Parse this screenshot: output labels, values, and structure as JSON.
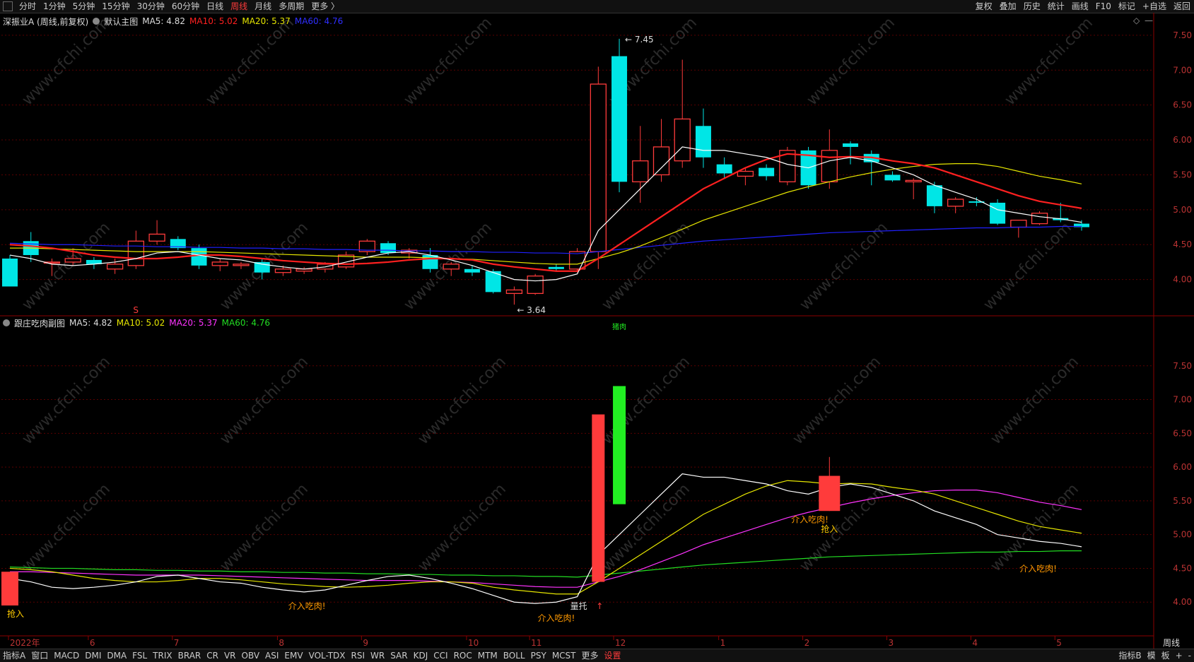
{
  "toolbar": {
    "left_items": [
      "分时",
      "1分钟",
      "5分钟",
      "15分钟",
      "30分钟",
      "60分钟",
      "日线",
      "周线",
      "月线",
      "多周期",
      "更多 〉"
    ],
    "active": "周线",
    "right_items": [
      "复权",
      "叠加",
      "历史",
      "统计",
      "画线",
      "F10",
      "标记",
      "+自选",
      "返回"
    ]
  },
  "main_title": {
    "name": "深振业A (周线,前复权)",
    "panel": "默认主图",
    "ma5": "MA5: 4.82",
    "ma10": "MA10: 5.02",
    "ma20": "MA20: 5.37",
    "ma60": "MA60: 4.76"
  },
  "sub_title": {
    "panel": "跟庄吃肉副图",
    "ma5": "MA5: 4.82",
    "ma10": "MA10: 5.02",
    "ma20": "MA20: 5.37",
    "ma60": "MA60: 4.76"
  },
  "bottombar": {
    "items": [
      "指标A",
      "窗口",
      "MACD",
      "DMI",
      "DMA",
      "FSL",
      "TRIX",
      "BRAR",
      "CR",
      "VR",
      "OBV",
      "ASI",
      "EMV",
      "VOL-TDX",
      "RSI",
      "WR",
      "SAR",
      "KDJ",
      "CCI",
      "ROC",
      "MTM",
      "BOLL",
      "PSY",
      "MCST",
      "更多",
      "设置"
    ],
    "active": "设置",
    "right_items": [
      "指标B",
      "模",
      "板",
      "+",
      "-"
    ]
  },
  "period_label": "周线",
  "watermark": "www.cfchi.com",
  "colors": {
    "up": "#ff3b3b",
    "down": "#00e6e6",
    "ma5": "#ffffff",
    "ma10": "#ff2020",
    "ma20": "#e6e600",
    "ma60_main": "#2020ff",
    "ma10_sub": "#e6e600",
    "ma20_sub": "#ff33ff",
    "ma60_sub": "#22dd22",
    "green_bar": "#22ee22",
    "annot": "#ff9900"
  },
  "chart_data": [
    {
      "type": "candlestick",
      "title": "默认主图",
      "yaxis_ticks": [
        4.0,
        4.5,
        5.0,
        5.5,
        6.0,
        6.5,
        7.0,
        7.5
      ],
      "ylim": [
        3.5,
        7.6
      ],
      "x_tick_labels": [
        "2022年",
        "6",
        "7",
        "8",
        "9",
        "10",
        "11",
        "12",
        "1",
        "2",
        "3",
        "4",
        "5"
      ],
      "candles": [
        {
          "o": 4.3,
          "h": 4.35,
          "l": 3.9,
          "c": 3.9
        },
        {
          "o": 4.55,
          "h": 4.68,
          "l": 4.25,
          "c": 4.35
        },
        {
          "o": 4.25,
          "h": 4.3,
          "l": 4.05,
          "c": 4.25
        },
        {
          "o": 4.25,
          "h": 4.45,
          "l": 4.2,
          "c": 4.3
        },
        {
          "o": 4.28,
          "h": 4.32,
          "l": 4.15,
          "c": 4.22
        },
        {
          "o": 4.15,
          "h": 4.3,
          "l": 4.08,
          "c": 4.22
        },
        {
          "o": 4.2,
          "h": 4.7,
          "l": 4.15,
          "c": 4.55
        },
        {
          "o": 4.55,
          "h": 4.85,
          "l": 4.5,
          "c": 4.65
        },
        {
          "o": 4.58,
          "h": 4.62,
          "l": 4.42,
          "c": 4.45
        },
        {
          "o": 4.45,
          "h": 4.5,
          "l": 4.15,
          "c": 4.2
        },
        {
          "o": 4.2,
          "h": 4.3,
          "l": 4.12,
          "c": 4.25
        },
        {
          "o": 4.2,
          "h": 4.25,
          "l": 4.15,
          "c": 4.22
        },
        {
          "o": 4.25,
          "h": 4.3,
          "l": 4.0,
          "c": 4.1
        },
        {
          "o": 4.1,
          "h": 4.2,
          "l": 4.05,
          "c": 4.15
        },
        {
          "o": 4.12,
          "h": 4.18,
          "l": 4.08,
          "c": 4.15
        },
        {
          "o": 4.15,
          "h": 4.25,
          "l": 4.1,
          "c": 4.22
        },
        {
          "o": 4.18,
          "h": 4.4,
          "l": 4.15,
          "c": 4.35
        },
        {
          "o": 4.4,
          "h": 4.58,
          "l": 4.35,
          "c": 4.55
        },
        {
          "o": 4.52,
          "h": 4.55,
          "l": 4.35,
          "c": 4.38
        },
        {
          "o": 4.38,
          "h": 4.45,
          "l": 4.3,
          "c": 4.42
        },
        {
          "o": 4.35,
          "h": 4.45,
          "l": 4.1,
          "c": 4.15
        },
        {
          "o": 4.15,
          "h": 4.25,
          "l": 4.05,
          "c": 4.22
        },
        {
          "o": 4.15,
          "h": 4.2,
          "l": 4.05,
          "c": 4.1
        },
        {
          "o": 4.12,
          "h": 4.15,
          "l": 3.8,
          "c": 3.82
        },
        {
          "o": 3.8,
          "h": 3.9,
          "l": 3.64,
          "c": 3.85
        },
        {
          "o": 3.8,
          "h": 4.08,
          "l": 3.78,
          "c": 4.05
        },
        {
          "o": 4.18,
          "h": 4.22,
          "l": 4.12,
          "c": 4.15
        },
        {
          "o": 4.15,
          "h": 4.45,
          "l": 4.1,
          "c": 4.4
        },
        {
          "o": 4.4,
          "h": 7.05,
          "l": 4.15,
          "c": 6.8
        },
        {
          "o": 7.2,
          "h": 7.45,
          "l": 5.25,
          "c": 5.4
        },
        {
          "o": 5.4,
          "h": 6.2,
          "l": 5.1,
          "c": 5.7
        },
        {
          "o": 5.5,
          "h": 6.3,
          "l": 5.4,
          "c": 5.9
        },
        {
          "o": 5.7,
          "h": 7.15,
          "l": 5.6,
          "c": 6.3
        },
        {
          "o": 6.2,
          "h": 6.45,
          "l": 5.6,
          "c": 5.75
        },
        {
          "o": 5.65,
          "h": 5.75,
          "l": 5.45,
          "c": 5.52
        },
        {
          "o": 5.48,
          "h": 5.6,
          "l": 5.35,
          "c": 5.55
        },
        {
          "o": 5.6,
          "h": 5.65,
          "l": 5.42,
          "c": 5.48
        },
        {
          "o": 5.4,
          "h": 5.9,
          "l": 5.35,
          "c": 5.85
        },
        {
          "o": 5.85,
          "h": 5.9,
          "l": 5.3,
          "c": 5.35
        },
        {
          "o": 5.4,
          "h": 6.15,
          "l": 5.3,
          "c": 5.85
        },
        {
          "o": 5.95,
          "h": 5.98,
          "l": 5.65,
          "c": 5.9
        },
        {
          "o": 5.8,
          "h": 5.85,
          "l": 5.35,
          "c": 5.68
        },
        {
          "o": 5.5,
          "h": 5.55,
          "l": 5.4,
          "c": 5.42
        },
        {
          "o": 5.4,
          "h": 5.45,
          "l": 5.15,
          "c": 5.42
        },
        {
          "o": 5.35,
          "h": 5.4,
          "l": 4.95,
          "c": 5.05
        },
        {
          "o": 5.05,
          "h": 5.18,
          "l": 4.95,
          "c": 5.15
        },
        {
          "o": 5.12,
          "h": 5.18,
          "l": 5.05,
          "c": 5.1
        },
        {
          "o": 5.1,
          "h": 5.15,
          "l": 4.78,
          "c": 4.8
        },
        {
          "o": 4.75,
          "h": 4.85,
          "l": 4.6,
          "c": 4.85
        },
        {
          "o": 4.8,
          "h": 4.98,
          "l": 4.78,
          "c": 4.95
        },
        {
          "o": 4.88,
          "h": 5.1,
          "l": 4.82,
          "c": 4.85
        },
        {
          "o": 4.8,
          "h": 4.85,
          "l": 4.7,
          "c": 4.75
        }
      ],
      "ma5": [
        4.35,
        4.3,
        4.22,
        4.2,
        4.22,
        4.25,
        4.3,
        4.38,
        4.4,
        4.35,
        4.3,
        4.28,
        4.22,
        4.18,
        4.15,
        4.18,
        4.25,
        4.32,
        4.38,
        4.4,
        4.35,
        4.28,
        4.2,
        4.1,
        4.0,
        3.98,
        4.0,
        4.08,
        4.7,
        5.0,
        5.3,
        5.6,
        5.9,
        5.85,
        5.85,
        5.8,
        5.75,
        5.65,
        5.6,
        5.7,
        5.75,
        5.7,
        5.6,
        5.5,
        5.35,
        5.25,
        5.15,
        5.0,
        4.95,
        4.9,
        4.87,
        4.82
      ],
      "ma10": [
        4.5,
        4.48,
        4.45,
        4.4,
        4.35,
        4.32,
        4.3,
        4.3,
        4.32,
        4.35,
        4.35,
        4.33,
        4.3,
        4.27,
        4.25,
        4.23,
        4.22,
        4.23,
        4.25,
        4.28,
        4.3,
        4.3,
        4.28,
        4.22,
        4.18,
        4.15,
        4.12,
        4.12,
        4.3,
        4.5,
        4.7,
        4.9,
        5.1,
        5.3,
        5.45,
        5.6,
        5.72,
        5.8,
        5.78,
        5.75,
        5.76,
        5.75,
        5.7,
        5.66,
        5.6,
        5.5,
        5.4,
        5.3,
        5.2,
        5.12,
        5.07,
        5.02
      ],
      "ma20": [
        4.45,
        4.45,
        4.44,
        4.43,
        4.42,
        4.41,
        4.4,
        4.4,
        4.4,
        4.4,
        4.39,
        4.38,
        4.37,
        4.36,
        4.35,
        4.34,
        4.33,
        4.32,
        4.32,
        4.32,
        4.31,
        4.3,
        4.29,
        4.27,
        4.25,
        4.23,
        4.22,
        4.22,
        4.3,
        4.38,
        4.48,
        4.6,
        4.72,
        4.85,
        4.95,
        5.05,
        5.15,
        5.25,
        5.33,
        5.4,
        5.47,
        5.53,
        5.58,
        5.62,
        5.65,
        5.66,
        5.66,
        5.62,
        5.55,
        5.48,
        5.43,
        5.37
      ],
      "ma60": [
        4.52,
        4.51,
        4.5,
        4.5,
        4.49,
        4.48,
        4.48,
        4.47,
        4.47,
        4.46,
        4.46,
        4.45,
        4.45,
        4.44,
        4.44,
        4.43,
        4.43,
        4.42,
        4.42,
        4.41,
        4.41,
        4.4,
        4.4,
        4.39,
        4.39,
        4.38,
        4.38,
        4.37,
        4.4,
        4.43,
        4.46,
        4.49,
        4.52,
        4.55,
        4.57,
        4.59,
        4.61,
        4.63,
        4.65,
        4.67,
        4.68,
        4.69,
        4.7,
        4.71,
        4.72,
        4.73,
        4.74,
        4.74,
        4.75,
        4.75,
        4.76,
        4.76
      ],
      "annotations": {
        "high": "7.45",
        "low": "3.64",
        "s_marker": "S"
      }
    },
    {
      "type": "indicator",
      "title": "跟庄吃肉副图",
      "yaxis_ticks": [
        4.0,
        4.5,
        5.0,
        5.5,
        6.0,
        6.5,
        7.0,
        7.5
      ],
      "ylim": [
        3.5,
        8.0
      ],
      "labels": {
        "qiangru": "抢入",
        "jieru": "介入吃肉!",
        "liangtuo": "量托",
        "zhurou": "猪肉"
      }
    }
  ]
}
